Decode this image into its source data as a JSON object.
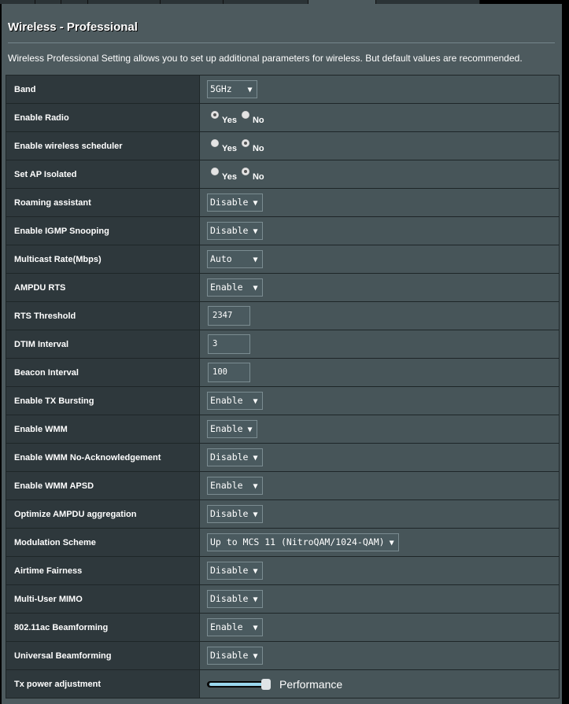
{
  "tabs": [
    {
      "label": "",
      "active": false
    },
    {
      "label": "",
      "active": false
    },
    {
      "label": "",
      "active": false
    },
    {
      "label": "",
      "active": false
    },
    {
      "label": "",
      "active": false
    },
    {
      "label": "",
      "active": false
    },
    {
      "label": "",
      "active": true
    },
    {
      "label": "",
      "active": false
    }
  ],
  "header": {
    "title": "Wireless - Professional",
    "description": "Wireless Professional Setting allows you to set up additional parameters for wireless. But default values are recommended."
  },
  "settings": [
    {
      "label": "Band",
      "type": "select",
      "value": "5GHz  "
    },
    {
      "label": "Enable Radio",
      "type": "radio",
      "options": [
        "Yes",
        "No"
      ],
      "selected": "Yes"
    },
    {
      "label": "Enable wireless scheduler",
      "type": "radio",
      "options": [
        "Yes",
        "No"
      ],
      "selected": "No"
    },
    {
      "label": "Set AP Isolated",
      "type": "radio",
      "options": [
        "Yes",
        "No"
      ],
      "selected": "No"
    },
    {
      "label": "Roaming assistant",
      "type": "select",
      "value": "Disable"
    },
    {
      "label": "Enable IGMP Snooping",
      "type": "select",
      "value": "Disable"
    },
    {
      "label": "Multicast Rate(Mbps)",
      "type": "select",
      "value": "Auto   "
    },
    {
      "label": "AMPDU RTS",
      "type": "select",
      "value": "Enable "
    },
    {
      "label": "RTS Threshold",
      "type": "input",
      "value": "2347"
    },
    {
      "label": "DTIM Interval",
      "type": "input",
      "value": "3"
    },
    {
      "label": "Beacon Interval",
      "type": "input",
      "value": "100"
    },
    {
      "label": "Enable TX Bursting",
      "type": "select",
      "value": "Enable "
    },
    {
      "label": "Enable WMM",
      "type": "select",
      "value": "Enable"
    },
    {
      "label": "Enable WMM No-Acknowledgement",
      "type": "select",
      "value": "Disable"
    },
    {
      "label": "Enable WMM APSD",
      "type": "select",
      "value": "Enable "
    },
    {
      "label": "Optimize AMPDU aggregation",
      "type": "select",
      "value": "Disable"
    },
    {
      "label": "Modulation Scheme",
      "type": "select",
      "value": "Up to MCS 11 (NitroQAM/1024-QAM)"
    },
    {
      "label": "Airtime Fairness",
      "type": "select",
      "value": "Disable"
    },
    {
      "label": "Multi-User MIMO",
      "type": "select",
      "value": "Disable"
    },
    {
      "label": "802.11ac Beamforming",
      "type": "select",
      "value": "Enable "
    },
    {
      "label": "Universal Beamforming",
      "type": "select",
      "value": "Disable"
    },
    {
      "label": "Tx power adjustment",
      "type": "slider",
      "value_fraction": 1.0,
      "value_label": "Performance"
    }
  ],
  "icons": {
    "dropdown_arrow": "▼"
  },
  "colors": {
    "page_bg": "#4d5a5e",
    "label_cell_bg": "#2e383c",
    "value_cell_bg": "#475559",
    "slider_fill": "#9ad8ee"
  }
}
